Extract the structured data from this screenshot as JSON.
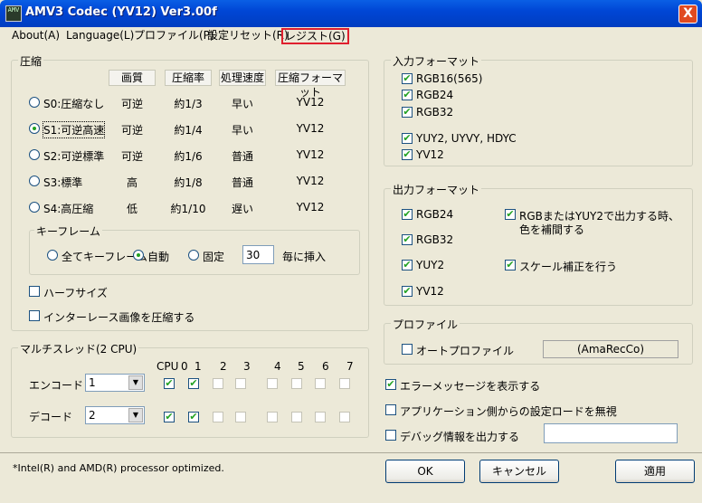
{
  "window": {
    "icon_text": "AMV",
    "title": "AMV3 Codec (YV12) Ver3.00f",
    "close": "X"
  },
  "menu": {
    "about": "About(A)",
    "language": "Language(L)",
    "profile": "プロファイル(P)",
    "reset": "設定リセット(R)",
    "register": "レジスト(G)"
  },
  "compress": {
    "title": "圧縮",
    "headers": [
      "画質",
      "圧縮率",
      "処理速度",
      "圧縮フォーマット"
    ],
    "rows": [
      {
        "label": "S0:圧縮なし",
        "quality": "可逆",
        "ratio": "約1/3",
        "speed": "早い",
        "format": "YV12",
        "selected": false
      },
      {
        "label": "S1:可逆高速",
        "quality": "可逆",
        "ratio": "約1/4",
        "speed": "早い",
        "format": "YV12",
        "selected": true
      },
      {
        "label": "S2:可逆標準",
        "quality": "可逆",
        "ratio": "約1/6",
        "speed": "普通",
        "format": "YV12",
        "selected": false
      },
      {
        "label": "S3:標準",
        "quality": "高",
        "ratio": "約1/8",
        "speed": "普通",
        "format": "YV12",
        "selected": false
      },
      {
        "label": "S4:高圧縮",
        "quality": "低",
        "ratio": "約1/10",
        "speed": "遅い",
        "format": "YV12",
        "selected": false
      }
    ],
    "keyframe": {
      "title": "キーフレーム",
      "all": "全てキーフレーム",
      "auto": "自動",
      "fixed": "固定",
      "interval": "30",
      "suffix": "毎に挿入",
      "selected": "auto"
    },
    "half_size": "ハーフサイズ",
    "interlace": "インターレース画像を圧縮する"
  },
  "thread": {
    "title": "マルチスレッド(2 CPU)",
    "cpu_header": "CPU",
    "cpu_labels": [
      "0",
      "1",
      "2",
      "3",
      "4",
      "5",
      "6",
      "7"
    ],
    "encode_label": "エンコード",
    "encode_value": "1",
    "decode_label": "デコード",
    "decode_value": "2",
    "encode_checks": [
      true,
      true,
      false,
      false,
      false,
      false,
      false,
      false
    ],
    "decode_checks": [
      true,
      true,
      false,
      false,
      false,
      false,
      false,
      false
    ]
  },
  "input_format": {
    "title": "入力フォーマット",
    "items": [
      {
        "label": "RGB16(565)",
        "checked": true
      },
      {
        "label": "RGB24",
        "checked": true
      },
      {
        "label": "RGB32",
        "checked": true
      },
      {
        "label": "YUY2, UYVY, HDYC",
        "checked": true
      },
      {
        "label": "YV12",
        "checked": true
      }
    ]
  },
  "output_format": {
    "title": "出力フォーマット",
    "items": [
      {
        "label": "RGB24",
        "checked": true
      },
      {
        "label": "RGB32",
        "checked": true
      },
      {
        "label": "YUY2",
        "checked": true
      },
      {
        "label": "YV12",
        "checked": true
      }
    ],
    "interpolate_line1": "RGBまたはYUY2で出力する時、",
    "interpolate_line2": "色を補間する",
    "scale_fix": "スケール補正を行う"
  },
  "profile": {
    "title": "プロファイル",
    "auto": "オートプロファイル",
    "name": "(AmaRecCo)"
  },
  "options": {
    "show_error": "エラーメッセージを表示する",
    "ignore_app": "アプリケーション側からの設定ロードを無視",
    "debug": "デバッグ情報を出力する",
    "debug_path": ""
  },
  "footer": {
    "note": "*Intel(R) and AMD(R) processor optimized.",
    "ok": "OK",
    "cancel": "キャンセル",
    "apply": "適用"
  }
}
